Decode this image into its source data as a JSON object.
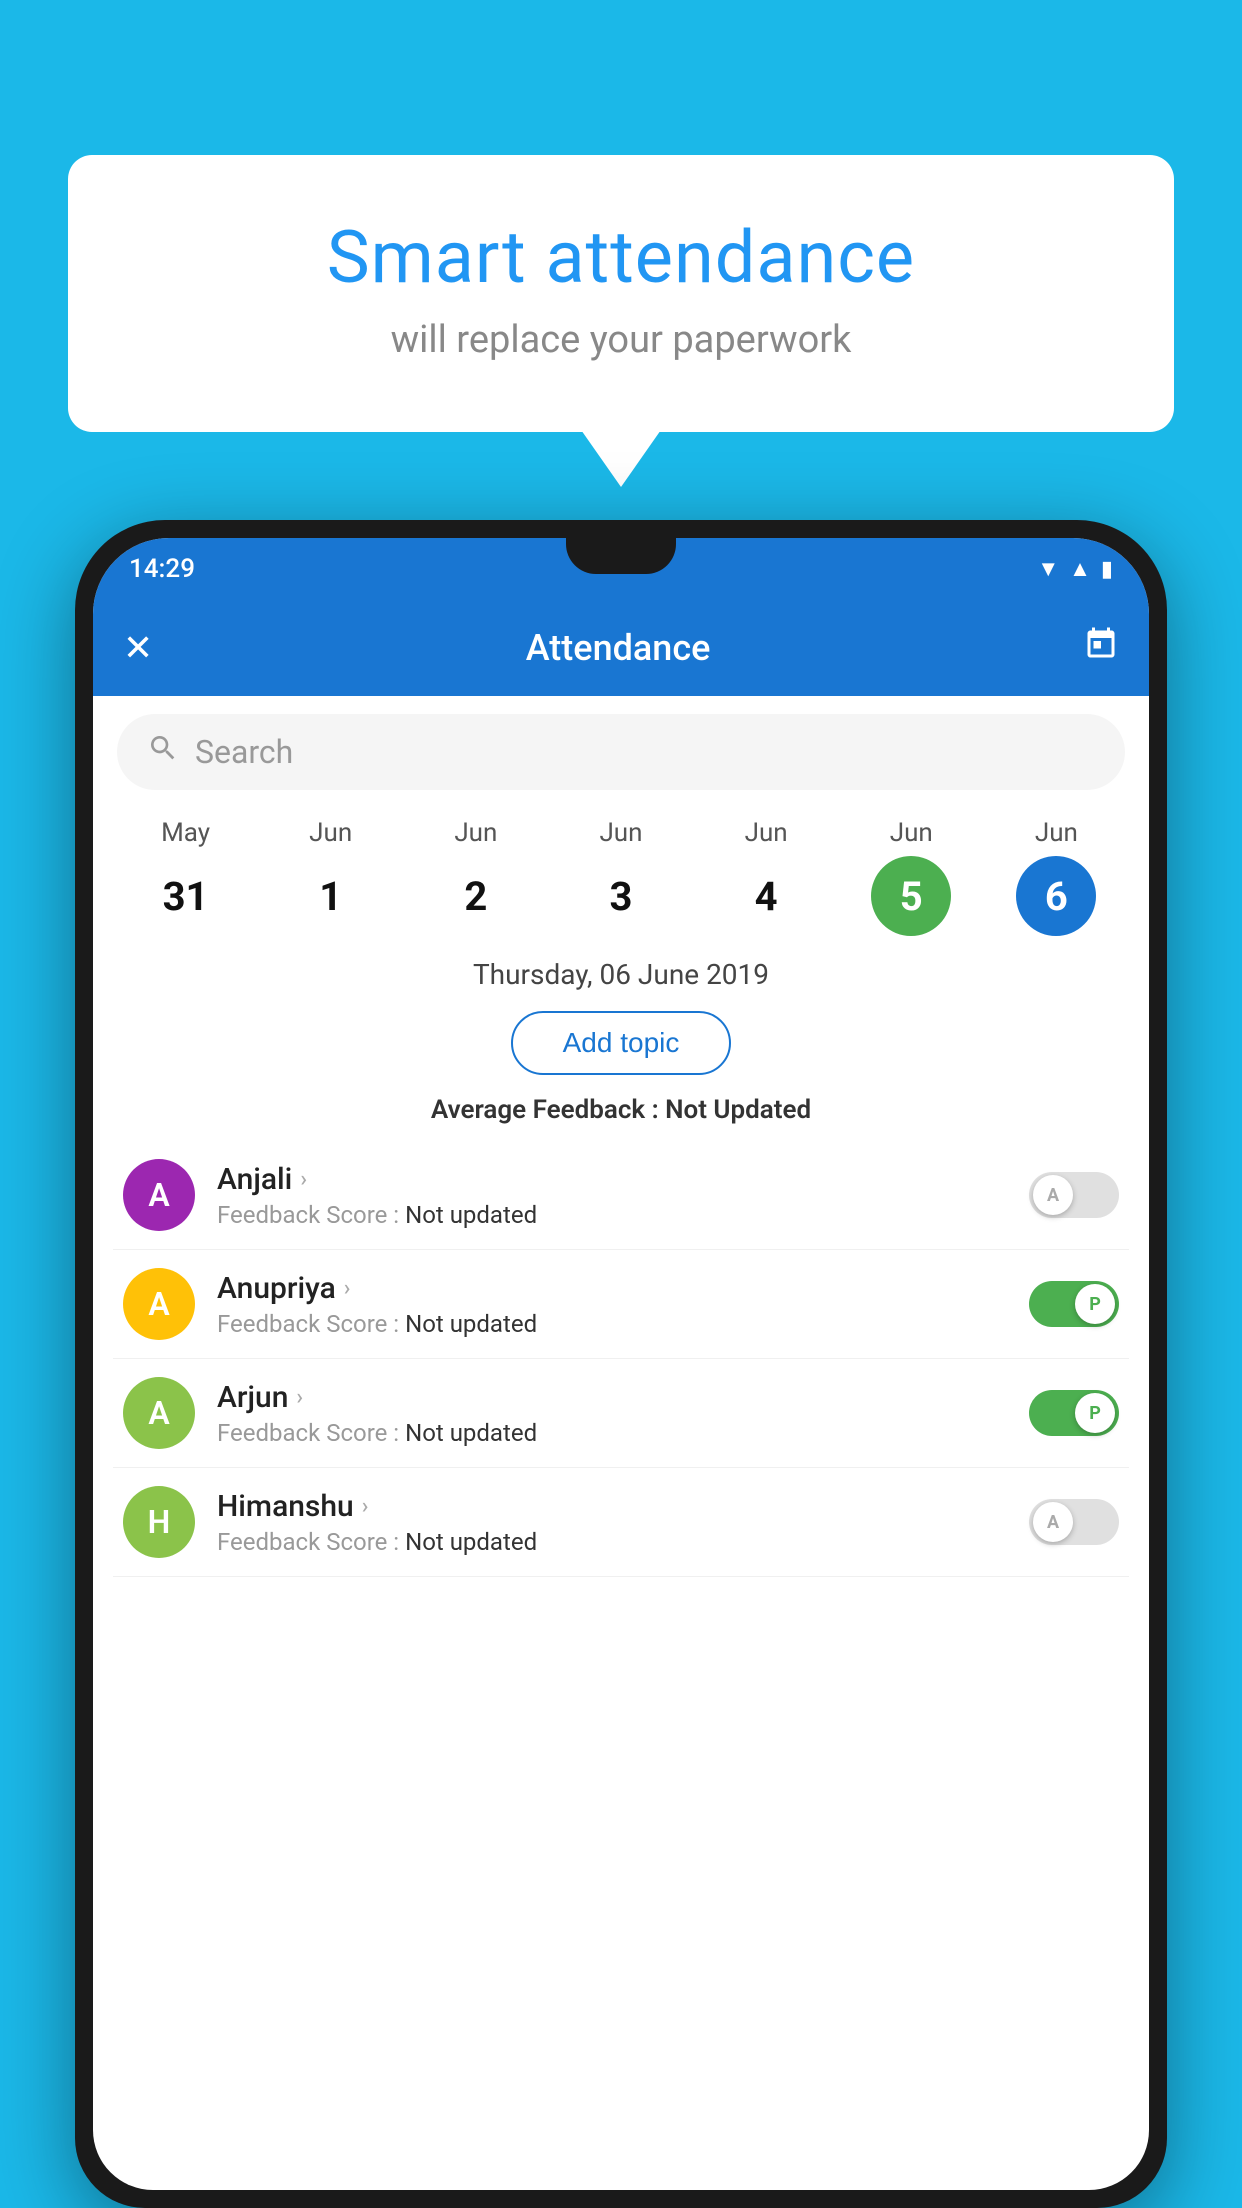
{
  "background": {
    "color": "#1BB8E8"
  },
  "bubble": {
    "title": "Smart attendance",
    "subtitle": "will replace your paperwork"
  },
  "statusBar": {
    "time": "14:29"
  },
  "appBar": {
    "title": "Attendance",
    "closeIcon": "✕",
    "calendarIcon": "📅"
  },
  "search": {
    "placeholder": "Search"
  },
  "calendar": {
    "days": [
      {
        "month": "May",
        "day": "31",
        "type": "normal"
      },
      {
        "month": "Jun",
        "day": "1",
        "type": "normal"
      },
      {
        "month": "Jun",
        "day": "2",
        "type": "normal"
      },
      {
        "month": "Jun",
        "day": "3",
        "type": "normal"
      },
      {
        "month": "Jun",
        "day": "4",
        "type": "normal"
      },
      {
        "month": "Jun",
        "day": "5",
        "type": "today"
      },
      {
        "month": "Jun",
        "day": "6",
        "type": "selected"
      }
    ]
  },
  "selectedDate": "Thursday, 06 June 2019",
  "addTopicLabel": "Add topic",
  "avgFeedback": {
    "label": "Average Feedback : ",
    "value": "Not Updated"
  },
  "students": [
    {
      "name": "Anjali",
      "avatarLetter": "A",
      "avatarColor": "#9C27B0",
      "feedbackLabel": "Feedback Score : ",
      "feedbackValue": "Not updated",
      "toggleState": "off",
      "toggleLabel": "A"
    },
    {
      "name": "Anupriya",
      "avatarLetter": "A",
      "avatarColor": "#FFC107",
      "feedbackLabel": "Feedback Score : ",
      "feedbackValue": "Not updated",
      "toggleState": "on",
      "toggleLabel": "P"
    },
    {
      "name": "Arjun",
      "avatarLetter": "A",
      "avatarColor": "#8BC34A",
      "feedbackLabel": "Feedback Score : ",
      "feedbackValue": "Not updated",
      "toggleState": "on",
      "toggleLabel": "P"
    },
    {
      "name": "Himanshu",
      "avatarLetter": "H",
      "avatarColor": "#8BC34A",
      "feedbackLabel": "Feedback Score : ",
      "feedbackValue": "Not updated",
      "toggleState": "off",
      "toggleLabel": "A"
    }
  ]
}
